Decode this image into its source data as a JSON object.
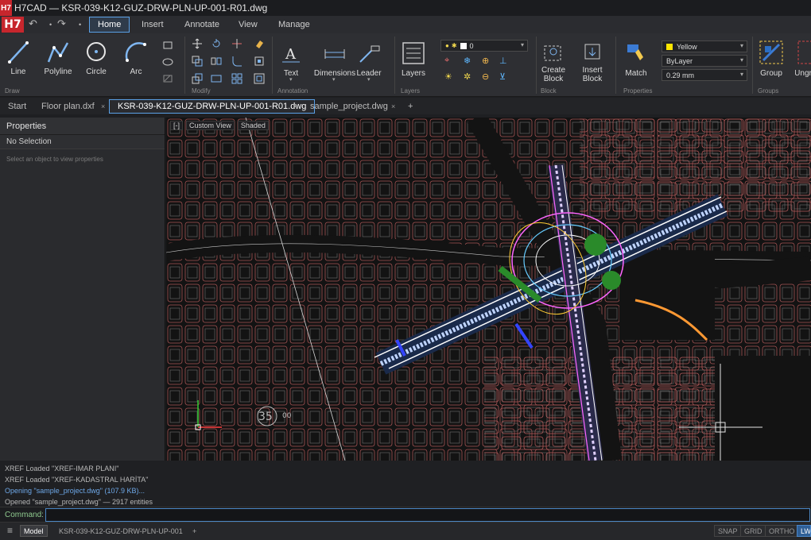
{
  "app": {
    "logo": "H7",
    "title": "H7CAD — KSR-039-K12-GUZ-DRW-PLN-UP-001-R01.dwg",
    "big_logo": "H7"
  },
  "ribbon_tabs": [
    "Home",
    "Insert",
    "Annotate",
    "View",
    "Manage"
  ],
  "ribbon": {
    "draw": {
      "line": "Line",
      "polyline": "Polyline",
      "circle": "Circle",
      "arc": "Arc",
      "group": "Draw"
    },
    "modify": {
      "group": "Modify"
    },
    "annotation": {
      "text": "Text",
      "dimensions": "Dimensions",
      "leader": "Leader",
      "group": "Annotation"
    },
    "layers": {
      "layers": "Layers",
      "layer_value": "0",
      "group": "Layers"
    },
    "block": {
      "create": "Create\nBlock",
      "create_1": "Create",
      "create_2": "Block",
      "insert_1": "Insert",
      "insert_2": "Block",
      "group": "Block"
    },
    "properties": {
      "match": "Match",
      "color": "Yellow",
      "linetype": "ByLayer",
      "lineweight": "0.29 mm",
      "group": "Properties"
    },
    "groups": {
      "group_btn": "Group",
      "ungroup_btn": "Ungr",
      "group": "Groups"
    },
    "colors": {
      "yellow": "#ffe600"
    }
  },
  "doc_tabs": [
    {
      "label": "Start"
    },
    {
      "label": "Floor plan.dxf",
      "close": "×"
    },
    {
      "label": "KSR-039-K12-GUZ-DRW-PLN-UP-001-R01.dwg",
      "close": "×"
    },
    {
      "label": "sample_project.dwg",
      "close": "×"
    },
    {
      "label": "+"
    }
  ],
  "properties_panel": {
    "header": "Properties",
    "selection": "No Selection",
    "hint": "Select an object to view properties"
  },
  "viewport": {
    "ctrl_minus": "[-]",
    "view": "Custom View",
    "shade": "Shaded",
    "label_35": "35",
    "label_00": "00"
  },
  "command_history": [
    "XREF  Loaded \"XREF-IMAR PLANI\"",
    "XREF  Loaded \"XREF-KADASTRAL HARİTA\"",
    "Opening \"sample_project.dwg\" (107.9 KB)...",
    "Opened \"sample_project.dwg\" — 2917 entities"
  ],
  "command": {
    "label": "Command:",
    "value": ""
  },
  "status": {
    "menu_icon": "≡",
    "model": "Model",
    "layout": "KSR-039-K12-GUZ-DRW-PLN-UP-001",
    "add": "+",
    "snap": "SNAP",
    "grid": "GRID",
    "ortho": "ORTHO",
    "lwt": "LWT"
  }
}
